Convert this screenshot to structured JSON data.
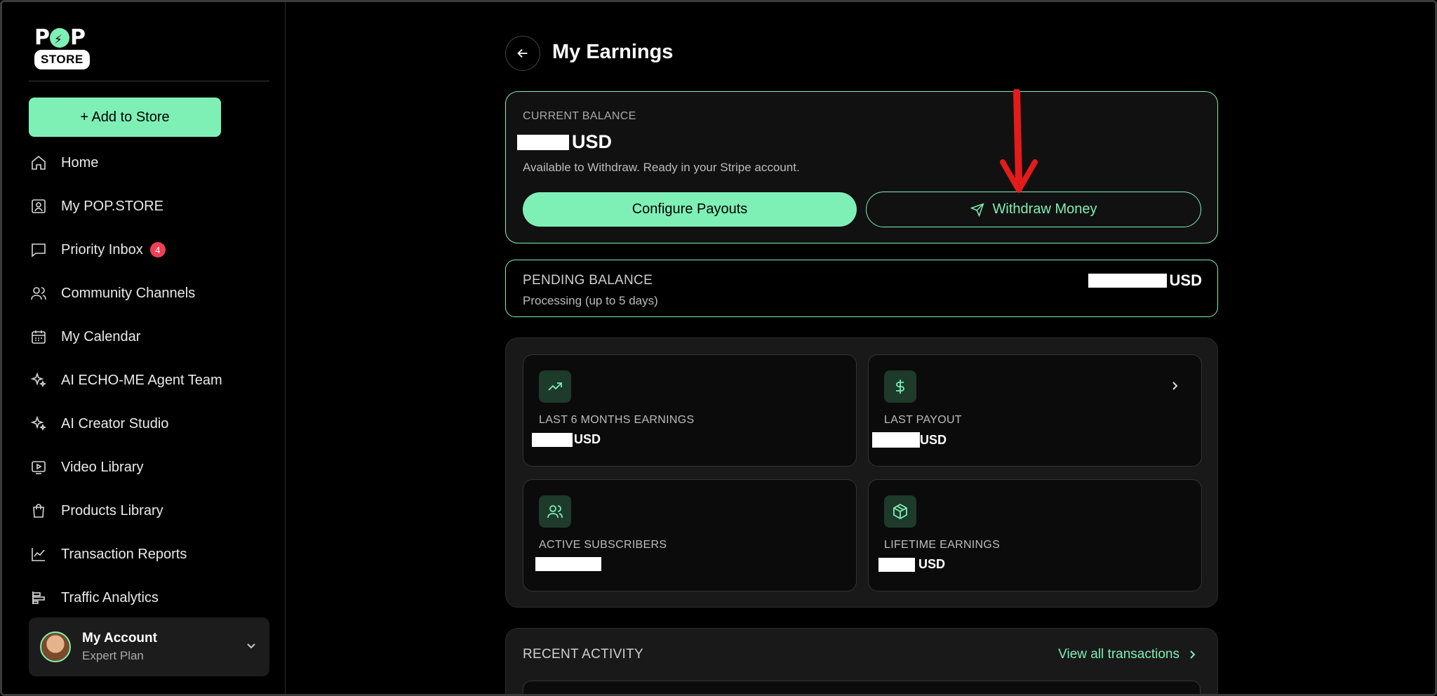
{
  "sidebar": {
    "logo": {
      "top": "POP",
      "bottom": "STORE"
    },
    "add_button": "+ Add to Store",
    "items": [
      {
        "label": "Home",
        "icon": "home-icon"
      },
      {
        "label": "My POP.STORE",
        "icon": "store-icon"
      },
      {
        "label": "Priority Inbox",
        "icon": "message-icon",
        "badge": "4"
      },
      {
        "label": "Community Channels",
        "icon": "users-icon"
      },
      {
        "label": "My Calendar",
        "icon": "calendar-icon"
      },
      {
        "label": "AI ECHO-ME Agent Team",
        "icon": "sparkles-icon"
      },
      {
        "label": "AI Creator Studio",
        "icon": "sparkles-icon"
      },
      {
        "label": "Video Library",
        "icon": "video-icon"
      },
      {
        "label": "Products Library",
        "icon": "shopping-bag-icon"
      },
      {
        "label": "Transaction Reports",
        "icon": "line-chart-icon"
      },
      {
        "label": "Traffic Analytics",
        "icon": "bar-chart-icon"
      }
    ],
    "account": {
      "name": "My Account",
      "plan": "Expert Plan"
    }
  },
  "header": {
    "title": "My Earnings"
  },
  "current_balance": {
    "label": "CURRENT BALANCE",
    "currency": "USD",
    "subtitle": "Available to Withdraw. Ready in your Stripe account.",
    "configure_label": "Configure Payouts",
    "withdraw_label": "Withdraw Money"
  },
  "pending_balance": {
    "label": "PENDING BALANCE",
    "subtitle": "Processing (up to 5 days)",
    "currency": "USD"
  },
  "stats": [
    {
      "label": "LAST 6 MONTHS EARNINGS",
      "currency": "USD",
      "icon": "trending-up-icon"
    },
    {
      "label": "LAST PAYOUT",
      "currency": "USD",
      "icon": "dollar-icon"
    },
    {
      "label": "ACTIVE SUBSCRIBERS",
      "currency": "",
      "icon": "users-icon"
    },
    {
      "label": "LIFETIME EARNINGS",
      "currency": "USD",
      "icon": "box-icon"
    }
  ],
  "recent_activity": {
    "title": "RECENT ACTIVITY",
    "link": "View all transactions"
  },
  "colors": {
    "accent": "#7ef0b6",
    "badge": "#ef4054",
    "annotation": "#e41b1b",
    "background": "#000000"
  }
}
